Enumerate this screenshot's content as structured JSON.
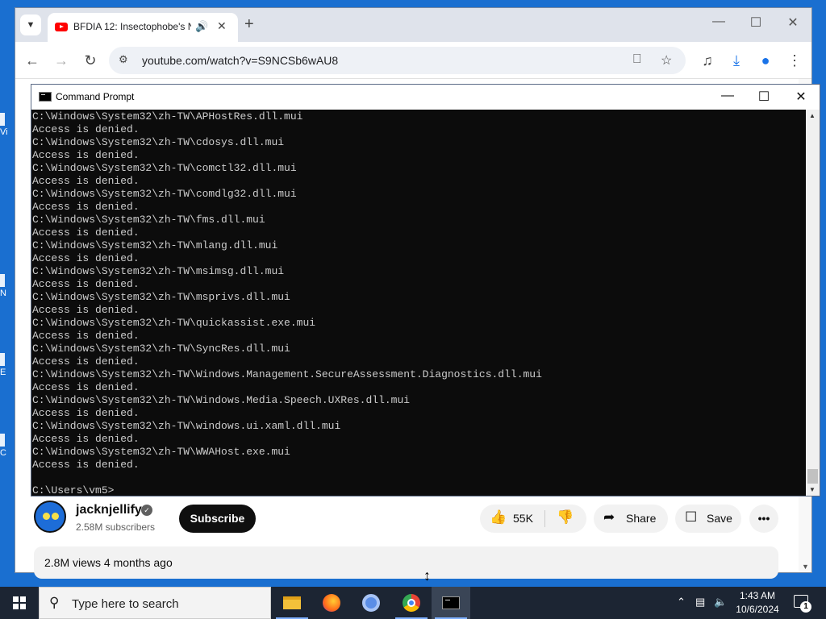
{
  "desktop": {
    "icon_fragments": [
      "Vi",
      "N",
      "E",
      "C"
    ]
  },
  "browser": {
    "tab_title": "BFDIA 12: Insectophobe's N",
    "url": "youtube.com/watch?v=S9NCSb6wAU8",
    "icons": [
      "youtube-icon",
      "audio-icon",
      "close-icon",
      "plus-icon",
      "back-icon",
      "forward-icon",
      "reload-icon",
      "site-info-icon",
      "install-app-icon",
      "bookmark-star-icon",
      "media-control-icon",
      "download-icon",
      "profile-icon",
      "menu-dots-icon"
    ]
  },
  "video": {
    "channel_name": "jacknjellify",
    "subscribers": "2.58M subscribers",
    "subscribe_label": "Subscribe",
    "likes": "55K",
    "share_label": "Share",
    "save_label": "Save",
    "more_label": "•••",
    "views_line": "2.8M views  4 months ago"
  },
  "cmd": {
    "title": "Command Prompt",
    "lines": [
      "C:\\Windows\\System32\\zh-TW\\APHostRes.dll.mui",
      "Access is denied.",
      "C:\\Windows\\System32\\zh-TW\\cdosys.dll.mui",
      "Access is denied.",
      "C:\\Windows\\System32\\zh-TW\\comctl32.dll.mui",
      "Access is denied.",
      "C:\\Windows\\System32\\zh-TW\\comdlg32.dll.mui",
      "Access is denied.",
      "C:\\Windows\\System32\\zh-TW\\fms.dll.mui",
      "Access is denied.",
      "C:\\Windows\\System32\\zh-TW\\mlang.dll.mui",
      "Access is denied.",
      "C:\\Windows\\System32\\zh-TW\\msimsg.dll.mui",
      "Access is denied.",
      "C:\\Windows\\System32\\zh-TW\\msprivs.dll.mui",
      "Access is denied.",
      "C:\\Windows\\System32\\zh-TW\\quickassist.exe.mui",
      "Access is denied.",
      "C:\\Windows\\System32\\zh-TW\\SyncRes.dll.mui",
      "Access is denied.",
      "C:\\Windows\\System32\\zh-TW\\Windows.Management.SecureAssessment.Diagnostics.dll.mui",
      "Access is denied.",
      "C:\\Windows\\System32\\zh-TW\\Windows.Media.Speech.UXRes.dll.mui",
      "Access is denied.",
      "C:\\Windows\\System32\\zh-TW\\windows.ui.xaml.dll.mui",
      "Access is denied.",
      "C:\\Windows\\System32\\zh-TW\\WWAHost.exe.mui",
      "Access is denied.",
      "",
      "C:\\Users\\vm5>"
    ]
  },
  "taskbar": {
    "search_placeholder": "Type here to search",
    "apps": [
      "file-explorer",
      "firefox",
      "chromium",
      "chrome",
      "command-prompt"
    ],
    "time": "1:43 AM",
    "date": "10/6/2024",
    "notification_count": "1"
  }
}
